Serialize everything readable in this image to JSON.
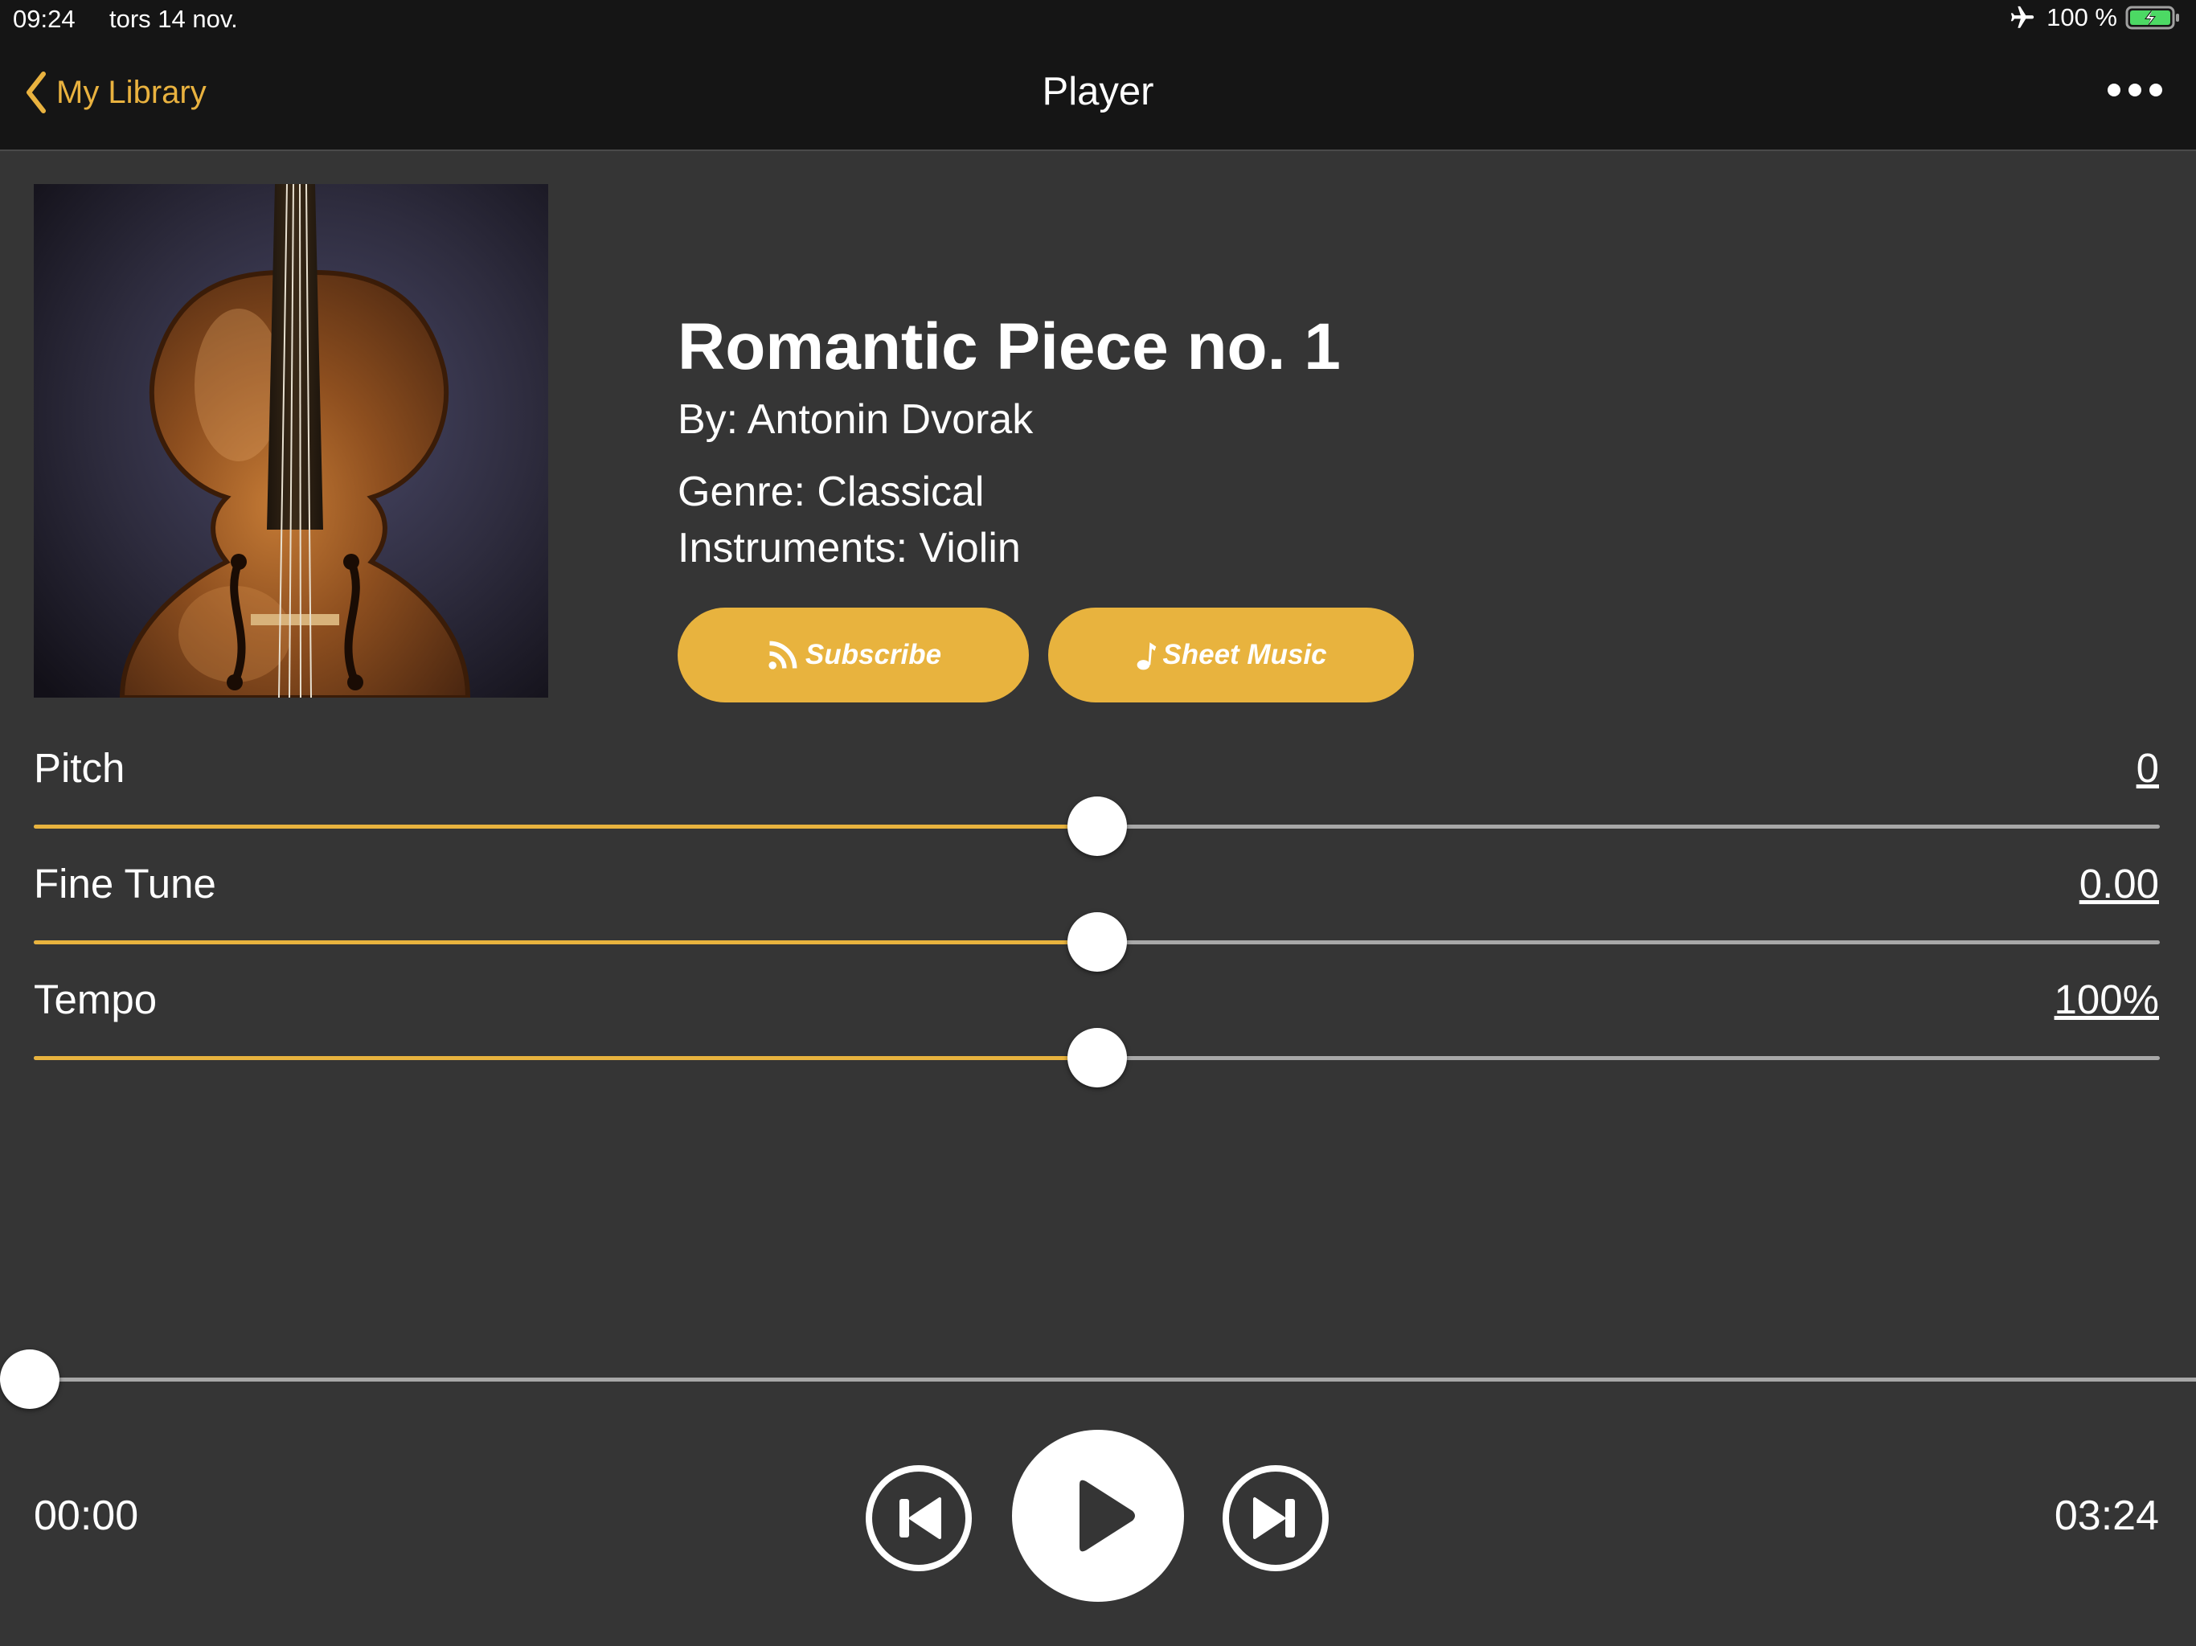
{
  "status_bar": {
    "time": "09:24",
    "date": "tors 14 nov.",
    "battery_percent": "100 %",
    "battery_level": 1.0,
    "icons": [
      "airplane-icon",
      "battery-charging-icon"
    ]
  },
  "nav": {
    "back_label": "My Library",
    "title": "Player",
    "more_icon": "ellipsis-icon"
  },
  "song": {
    "title": "Romantic Piece no. 1",
    "composer": "By: Antonin Dvorak",
    "genre": "Genre: Classical",
    "instruments": "Instruments: Violin",
    "cover_image": "violin-cover-art"
  },
  "actions": {
    "subscribe_label": "Subscribe",
    "subscribe_icon": "rss-icon",
    "sheet_music_label": "Sheet Music",
    "sheet_music_icon": "music-note-icon"
  },
  "sliders": {
    "pitch": {
      "label": "Pitch",
      "value": "0",
      "level": 0.5
    },
    "fine_tune": {
      "label": "Fine Tune",
      "value": "0.00",
      "level": 0.5
    },
    "tempo": {
      "label": "Tempo",
      "value": "100%",
      "level": 0.5
    }
  },
  "playback": {
    "current_time": "00:00",
    "total_time": "03:24",
    "progress": 0.0,
    "controls": [
      "skip-back-icon",
      "play-icon",
      "skip-forward-icon"
    ]
  },
  "colors": {
    "accent": "#e8b33e",
    "background": "#353535",
    "bar_background": "#151515",
    "track": "#a8a8a8",
    "battery": "#4cd964"
  }
}
